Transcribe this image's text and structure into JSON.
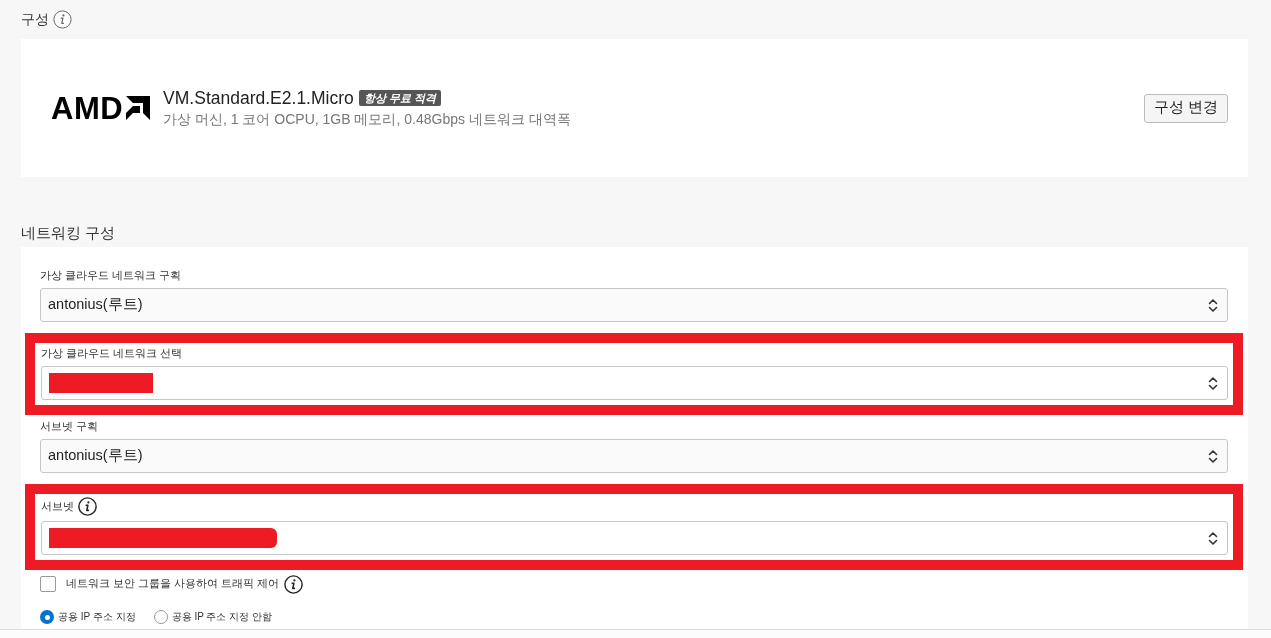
{
  "shape_section": {
    "title": "구성",
    "info": true,
    "logo_text": "AMD",
    "shape_name": "VM.Standard.E2.1.Micro",
    "badge": "항상 무료 적격",
    "details": "가상 머신, 1 코어 OCPU, 1GB 메모리, 0.48Gbps 네트워크 대역폭",
    "button": "구성 변경"
  },
  "networking": {
    "title": "네트워킹 구성",
    "fields": [
      {
        "label": "가상 클라우드 네트워크 구획",
        "value": "antonius(루트)",
        "info": false,
        "highlighted": false,
        "redacted": false
      },
      {
        "label": "가상 클라우드 네트워크 선택",
        "info": false,
        "highlighted": true,
        "redacted": true
      },
      {
        "label": "서브넷 구획",
        "value": "antonius(루트)",
        "info": false,
        "highlighted": false,
        "redacted": false
      },
      {
        "label": "서브넷",
        "info": true,
        "highlighted": true,
        "redacted": true
      }
    ],
    "checkbox": {
      "label": "네트워크 보안 그룹을 사용하여 트래픽 제어",
      "checked": false,
      "info": true
    },
    "radios": [
      {
        "label": "공용 IP 주소 지정",
        "selected": true
      },
      {
        "label": "공용 IP 주소 지정 안함",
        "selected": false
      }
    ]
  }
}
